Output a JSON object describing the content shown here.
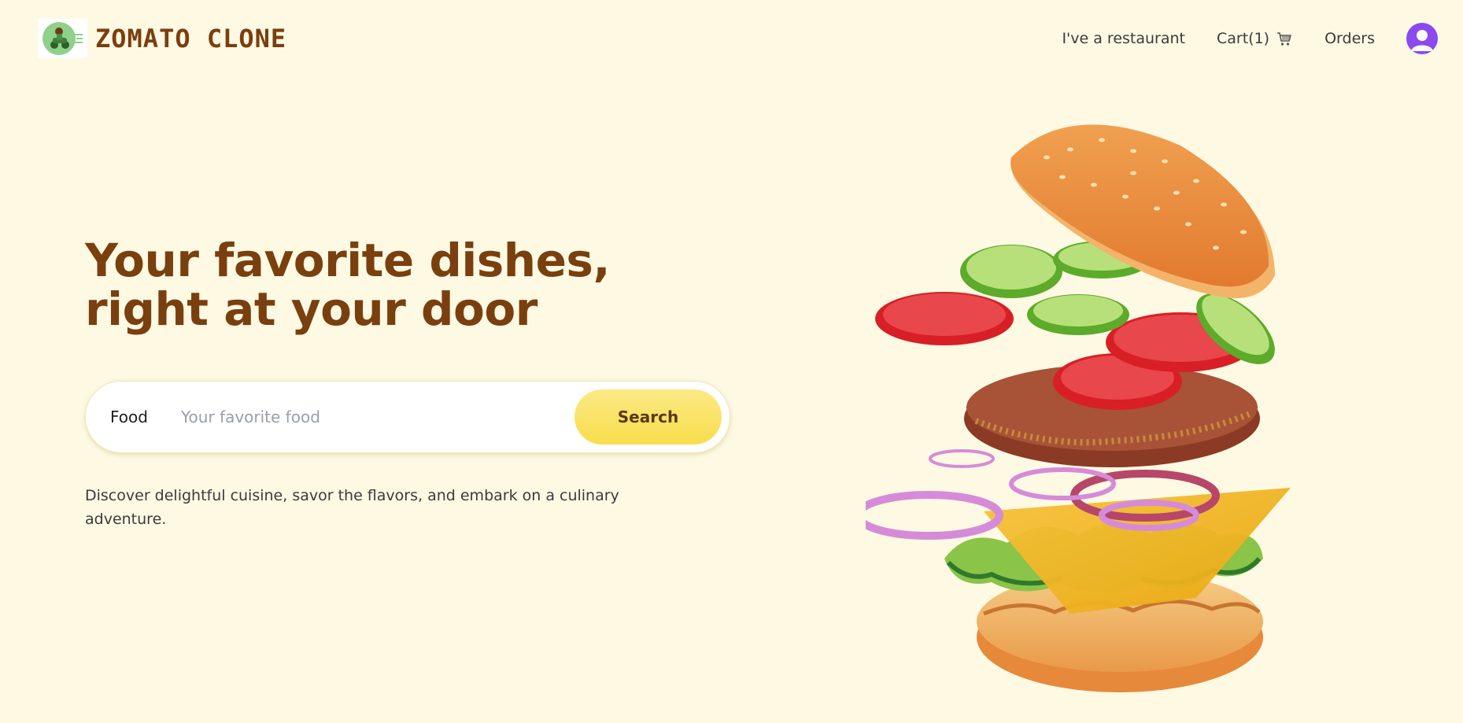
{
  "header": {
    "brand": "ZOMATO CLONE",
    "logo_icon": "delivery-rider-logo",
    "nav": {
      "restaurant": "I've a restaurant",
      "cart": "Cart(1)",
      "cart_icon": "cart-icon",
      "orders": "Orders",
      "avatar_icon": "user-avatar-icon"
    }
  },
  "hero": {
    "title_line1": "Your favorite dishes,",
    "title_line2": "right at your door",
    "search": {
      "label": "Food",
      "placeholder": "Your favorite food",
      "value": "",
      "button": "Search"
    },
    "subtitle": "Discover delightful cuisine, savor the flavors, and embark on a culinary adventure.",
    "image": "exploded-burger-illustration"
  },
  "colors": {
    "background": "#fdf9e3",
    "brand_brown": "#7a3f0e",
    "accent_yellow": "#f8dd4c",
    "avatar_purple": "#8b49f0"
  }
}
